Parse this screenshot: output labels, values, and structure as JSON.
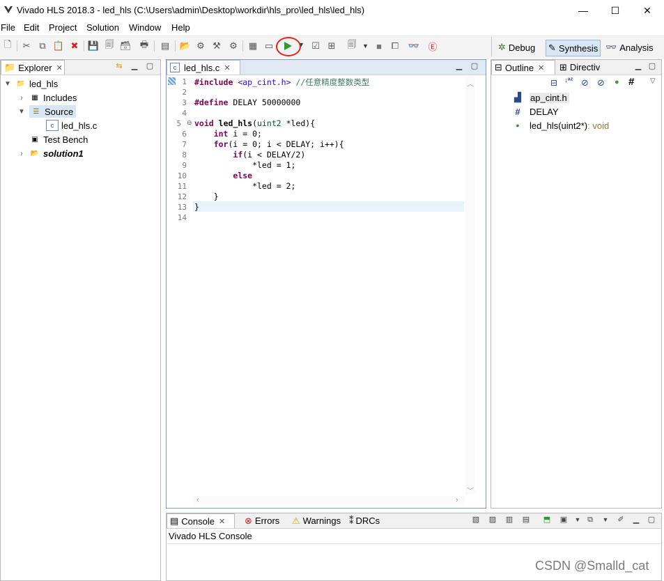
{
  "window": {
    "title": "Vivado HLS 2018.3 - led_hls (C:\\Users\\admin\\Desktop\\workdir\\hls_pro\\led_hls\\led_hls)",
    "minimize": "—",
    "maximize": "☐",
    "close": "✕"
  },
  "menu": [
    {
      "label": "File"
    },
    {
      "label": "Edit"
    },
    {
      "label": "Project"
    },
    {
      "label": "Solution"
    },
    {
      "label": "Window"
    },
    {
      "label": "Help"
    }
  ],
  "perspectives": {
    "debug": "Debug",
    "synthesis": "Synthesis",
    "analysis": "Analysis"
  },
  "explorer": {
    "tab": "Explorer",
    "tree": [
      {
        "label": "led_hls"
      },
      {
        "label": "Includes"
      },
      {
        "label": "Source"
      },
      {
        "label": "led_hls.c"
      },
      {
        "label": "Test Bench"
      },
      {
        "label": "solution1"
      }
    ]
  },
  "editor": {
    "tab": "led_hls.c",
    "line_numbers": [
      "1",
      "2",
      "3",
      "4",
      "5",
      "6",
      "7",
      "8",
      "9",
      "10",
      "11",
      "12",
      "13",
      "14"
    ]
  },
  "outline": {
    "tab": "Outline",
    "tab2": "Directiv",
    "items": [
      {
        "label": "ap_cint.h"
      },
      {
        "label": "DELAY"
      },
      {
        "label": "led_hls(uint2*)",
        "suffix": " : void"
      }
    ]
  },
  "console": {
    "tabs": [
      "Console",
      "Errors",
      "Warnings",
      "DRCs"
    ],
    "title": "Vivado HLS Console"
  },
  "watermark": "CSDN @Smalld_cat",
  "colors": {
    "selection": "#d8e6f5",
    "current_line": "#e8f2fe",
    "run_highlight": "#e0241b",
    "run_icon": "#2e9b2e",
    "keyword": "#7f0055"
  }
}
